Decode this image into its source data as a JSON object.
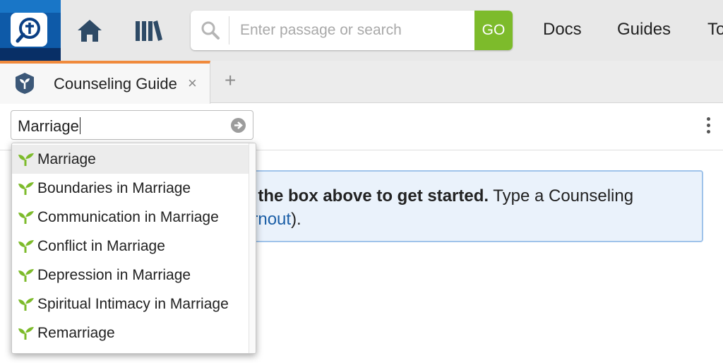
{
  "app": {
    "brand_colors": {
      "logo_blue": "#0a3f84",
      "go_green": "#7dbb2b",
      "tab_accent": "#f08a3c",
      "sprout_green": "#7dbb2b",
      "link_blue": "#1b5fa7"
    }
  },
  "header": {
    "logo_icon": "logos-search-cross-icon",
    "home_icon": "home-icon",
    "library_icon": "library-books-icon",
    "search": {
      "placeholder": "Enter passage or search",
      "value": "",
      "search_icon": "magnifier-icon",
      "go_label": "GO"
    },
    "nav": [
      {
        "label": "Docs"
      },
      {
        "label": "Guides"
      },
      {
        "label": "To"
      }
    ]
  },
  "tabs": {
    "items": [
      {
        "label": "Counseling Guide",
        "icon": "shield-sprout-icon",
        "active": true
      }
    ],
    "close_label": "×",
    "add_label": "+"
  },
  "toolbar": {
    "guide_search_value": "Marriage",
    "submit_icon": "arrow-circle-icon",
    "more_icon": "vertical-ellipsis-icon"
  },
  "info": {
    "line1_bold": "n the box above to get started.",
    "line1_rest": " Type a Counseling",
    "line2_link": "urnout",
    "line2_rest": ")."
  },
  "dropdown": {
    "items": [
      {
        "label": "Marriage",
        "icon": "sprout-icon",
        "highlighted": true
      },
      {
        "label": "Boundaries in Marriage",
        "icon": "sprout-icon"
      },
      {
        "label": "Communication in Marriage",
        "icon": "sprout-icon"
      },
      {
        "label": "Conflict in Marriage",
        "icon": "sprout-icon"
      },
      {
        "label": "Depression in Marriage",
        "icon": "sprout-icon"
      },
      {
        "label": "Spiritual Intimacy in Marriage",
        "icon": "sprout-icon"
      },
      {
        "label": "Remarriage",
        "icon": "sprout-icon"
      }
    ]
  }
}
